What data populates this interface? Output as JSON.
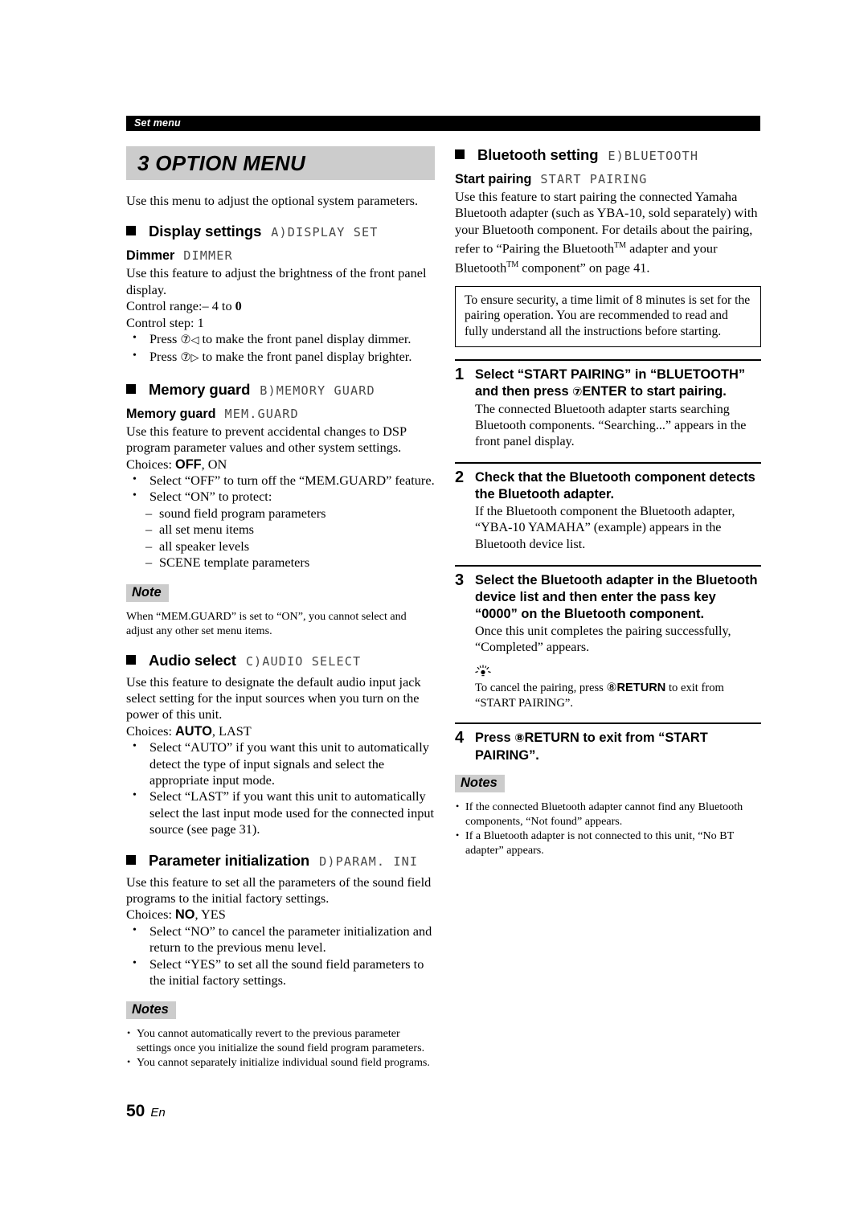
{
  "header": {
    "running_head": "Set menu"
  },
  "footer": {
    "page_number": "50",
    "language": "En"
  },
  "title_band": {
    "text": "3 OPTION MENU"
  },
  "left_column": {
    "intro": "Use this menu to adjust the optional system parameters.",
    "display_settings": {
      "heading": "Display settings",
      "lcd": "A)DISPLAY SET",
      "dimmer": {
        "sub_heading": "Dimmer",
        "lcd": "DIMMER",
        "body": "Use this feature to adjust the brightness of the front panel display.",
        "control_range_label": "Control range:",
        "control_range_value_prefix": "– 4 to ",
        "control_range_value_bold": "0",
        "control_step": "Control step: 1",
        "bullets": [
          {
            "pre": "Press ",
            "circled": "⑦",
            "arrow": "◁",
            "post": " to make the front panel display dimmer."
          },
          {
            "pre": "Press ",
            "circled": "⑦",
            "arrow": "▷",
            "post": " to make the front panel display brighter."
          }
        ]
      }
    },
    "memory_guard": {
      "heading": "Memory guard",
      "lcd": "B)MEMORY GUARD",
      "sub_heading": "Memory guard",
      "sub_lcd": "MEM.GUARD",
      "body": "Use this feature to prevent accidental changes to DSP program parameter values and other system settings.",
      "choices_label": "Choices: ",
      "choices_bold": "OFF",
      "choices_rest": ", ON",
      "bullets": [
        "Select “OFF” to turn off the “MEM.GUARD” feature.",
        "Select “ON” to protect:"
      ],
      "dashes": [
        "sound field program parameters",
        "all set menu items",
        "all speaker levels",
        "SCENE template parameters"
      ],
      "note_badge": "Note",
      "note_text": "When “MEM.GUARD” is set to “ON”, you cannot select and adjust any other set menu items."
    },
    "audio_select": {
      "heading": "Audio select",
      "lcd": "C)AUDIO SELECT",
      "body": "Use this feature to designate the default audio input jack select setting for the input sources when you turn on the power of this unit.",
      "choices_label": "Choices: ",
      "choices_bold": "AUTO",
      "choices_rest": ", LAST",
      "bullets": [
        "Select “AUTO” if you want this unit to automatically detect the type of input signals and select the appropriate input mode.",
        "Select “LAST” if you want this unit to automatically select the last input mode used for the connected input source (see page 31)."
      ]
    },
    "parameter_initialization": {
      "heading": "Parameter initialization",
      "lcd": "D)PARAM. INI",
      "body": "Use this feature to set all the parameters of the sound field programs to the initial factory settings.",
      "choices_label": "Choices: ",
      "choices_bold": "NO",
      "choices_rest": ", YES",
      "bullets": [
        "Select “NO” to cancel the parameter initialization and return to the previous menu level.",
        "Select “YES” to set all the sound field parameters to the initial factory settings."
      ],
      "notes_badge": "Notes",
      "notes": [
        "You cannot automatically revert to the previous parameter settings once you initialize the sound field program parameters.",
        "You cannot separately initialize individual sound field programs."
      ]
    }
  },
  "right_column": {
    "bluetooth_setting": {
      "heading": "Bluetooth setting",
      "lcd": "E)BLUETOOTH",
      "sub_heading": "Start pairing",
      "sub_lcd": "START PAIRING",
      "body_part1": "Use this feature to start pairing the connected Yamaha Bluetooth adapter (such as YBA-10, sold separately) with your Bluetooth component. For details about the pairing, refer to “Pairing the Bluetooth",
      "body_tm1": "TM",
      "body_part2": " adapter and your Bluetooth",
      "body_tm2": "TM",
      "body_part3": " component” on page 41.",
      "caution": "To ensure security, a time limit of 8 minutes is set for the pairing operation. You are recommended to read and fully understand all the instructions before starting."
    },
    "steps": [
      {
        "number": "1",
        "title_pre": "Select “START PAIRING” in “BLUETOOTH” and then press ",
        "title_circled": "⑦",
        "title_key": "ENTER",
        "title_post": " to start pairing.",
        "desc": "The connected Bluetooth adapter starts searching Bluetooth components. “Searching...” appears in the front panel display."
      },
      {
        "number": "2",
        "title_pre": "Check that the Bluetooth component detects the Bluetooth adapter.",
        "title_circled": "",
        "title_key": "",
        "title_post": "",
        "desc": "If the Bluetooth component the Bluetooth adapter, “YBA-10 YAMAHA” (example) appears in the Bluetooth device list."
      },
      {
        "number": "3",
        "title_pre": "Select the Bluetooth adapter in the Bluetooth device list and then enter the pass key “0000” on the Bluetooth component.",
        "title_circled": "",
        "title_key": "",
        "title_post": "",
        "desc": "Once this unit completes the pairing successfully, “Completed” appears."
      }
    ],
    "step3_tip": {
      "glyph": "tip-lightbulb-icon",
      "pre": "To cancel the pairing, press ",
      "circled": "⑧",
      "key": "RETURN",
      "post": " to exit from “START PAIRING”."
    },
    "step4": {
      "number": "4",
      "title_pre": "Press ",
      "title_circled": "⑧",
      "title_key": "RETURN",
      "title_post": " to exit from “START PAIRING”."
    },
    "notes_badge": "Notes",
    "notes": [
      "If the connected Bluetooth adapter cannot find any Bluetooth components, “Not found” appears.",
      "If a Bluetooth adapter is not connected to this unit, “No BT adapter” appears."
    ]
  }
}
